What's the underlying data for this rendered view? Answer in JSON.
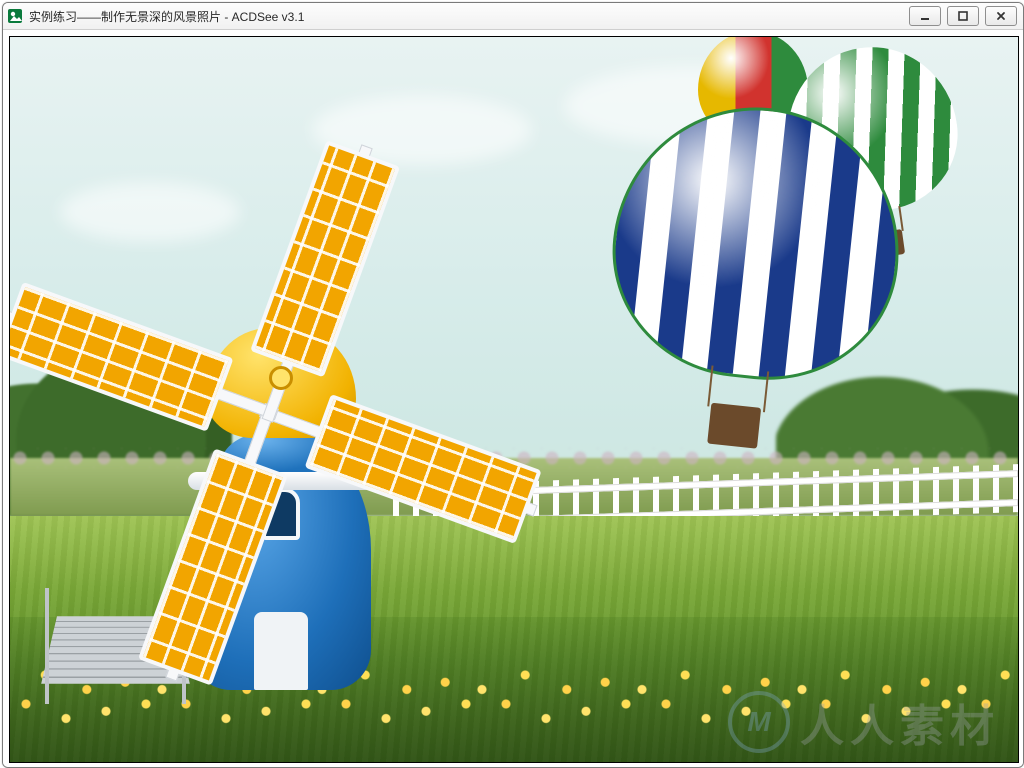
{
  "window": {
    "title": "实例练习——制作无景深的风景照片 - ACDSee v3.1",
    "app_name": "ACDSee",
    "app_version": "v3.1"
  },
  "controls": {
    "minimize": "minimize",
    "maximize": "maximize",
    "close": "close"
  },
  "scene": {
    "description": "Landscape photo: blue-and-yellow Dutch-style windmill on green lawn with yellow flowers, white picket fence, flowering hedge, trees, three hot-air balloons in pale sky.",
    "windmill": {
      "body_color": "#1e6fb9",
      "dome_color": "#f2b200",
      "sail_panel_color": "#f2a500"
    },
    "balloons": [
      {
        "id": "large-blue-white",
        "stripes": [
          "#1a3a8a",
          "#ffffff"
        ],
        "trim": "#2e8b3d"
      },
      {
        "id": "green-white",
        "stripes": [
          "#2e8b3d",
          "#ffffff"
        ]
      },
      {
        "id": "tricolor",
        "segments": [
          "#e6b800",
          "#d1332e",
          "#2e8b3d"
        ]
      }
    ],
    "fence_color": "#ffffff",
    "lawn_color": "#7aa837",
    "sky_color": "#d7ecea"
  },
  "watermark": {
    "logo_letter": "M",
    "text": "人人素材"
  }
}
